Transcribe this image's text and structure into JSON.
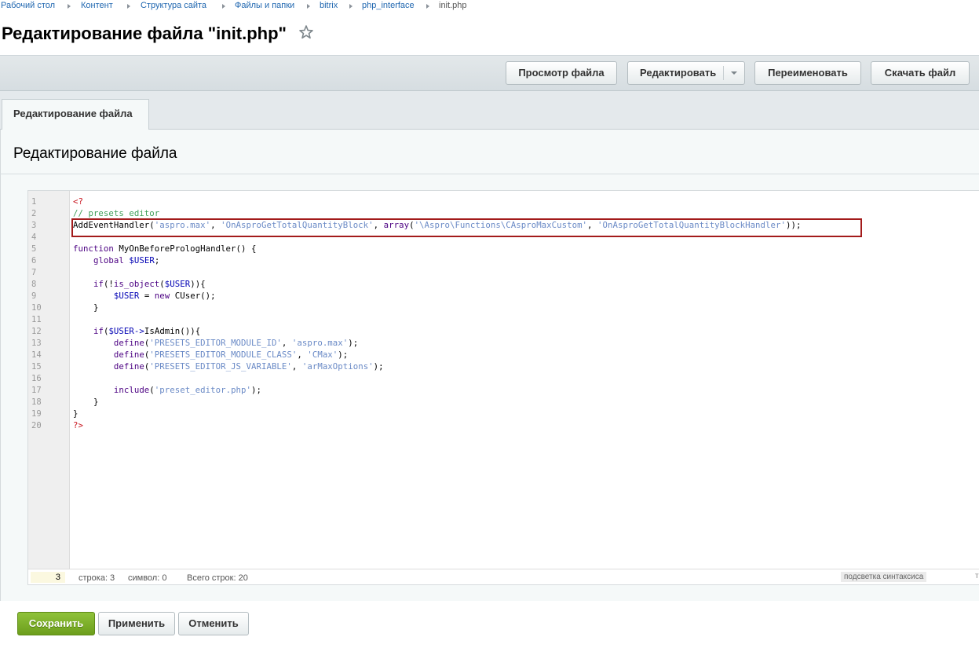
{
  "breadcrumb": {
    "items": [
      "Рабочий стол",
      "Контент",
      "Структура сайта",
      "Файлы и папки",
      "bitrix",
      "php_interface",
      "init.php"
    ]
  },
  "page": {
    "title": "Редактирование файла \"init.php\""
  },
  "toolbar": {
    "view_label": "Просмотр файла",
    "edit_label": "Редактировать",
    "rename_label": "Переименовать",
    "download_label": "Скачать файл"
  },
  "tabs": [
    {
      "label": "Редактирование файла",
      "active": true
    }
  ],
  "section": {
    "title": "Редактирование файла"
  },
  "editor": {
    "line_numbers": [
      "1",
      "2",
      "3",
      "4",
      "5",
      "6",
      "7",
      "8",
      "9",
      "10",
      "11",
      "12",
      "13",
      "14",
      "15",
      "16",
      "17",
      "18",
      "19",
      "20"
    ],
    "lines": [
      "<?",
      "// presets editor",
      "AddEventHandler('aspro.max', 'OnAsproGetTotalQuantityBlock', array('\\Aspro\\Functions\\CAsproMaxCustom', 'OnAsproGetTotalQuantityBlockHandler'));",
      "",
      "function MyOnBeforePrologHandler() {",
      "    global $USER;",
      "",
      "    if(!is_object($USER)){",
      "        $USER = new CUser();",
      "    }",
      "",
      "    if($USER->IsAdmin()){",
      "        define('PRESETS_EDITOR_MODULE_ID', 'aspro.max');",
      "        define('PRESETS_EDITOR_MODULE_CLASS', 'CMax');",
      "        define('PRESETS_EDITOR_JS_VARIABLE', 'arMaxOptions');",
      "",
      "        include('preset_editor.php');",
      "    }",
      "}",
      "?>"
    ],
    "status": {
      "current_line": "3",
      "line_text": "строка: 3",
      "symbol_text": "символ: 0",
      "total_text": "Всего строк: 20",
      "highlight_toggle": "подсветка синтаксиса",
      "edge_char": "т"
    }
  },
  "actions": {
    "save_label": "Сохранить",
    "apply_label": "Применить",
    "cancel_label": "Отменить"
  },
  "colors": {
    "accent_green": "#7cb22a",
    "link_blue": "#2067b0",
    "highlight_red": "#a31b1b"
  }
}
